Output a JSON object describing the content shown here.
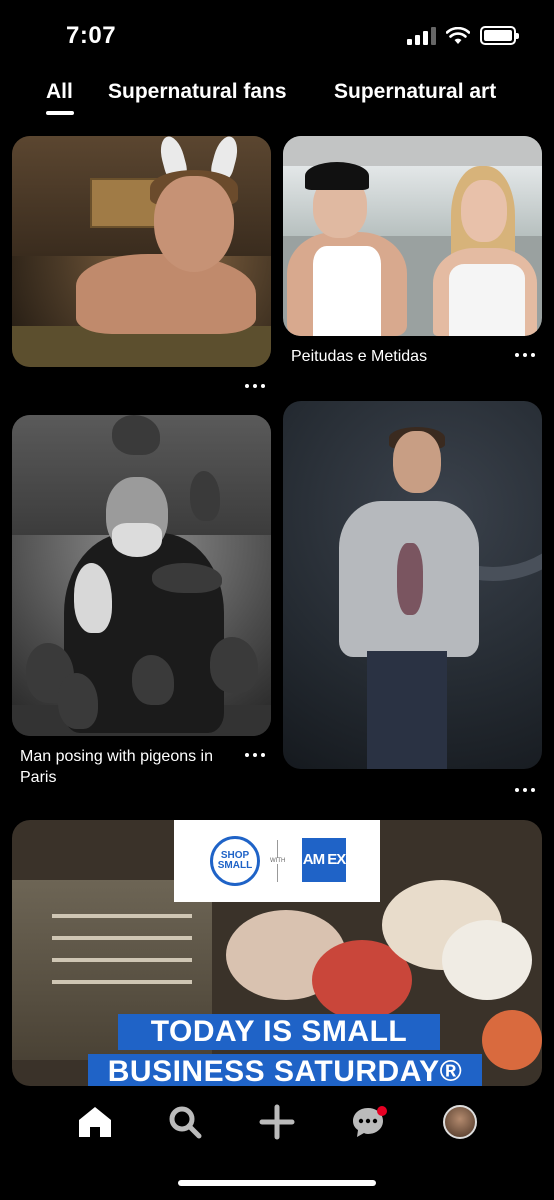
{
  "status_bar": {
    "time": "7:07"
  },
  "tabs": [
    {
      "label": "All",
      "selected": true
    },
    {
      "label": "Supernatural fans",
      "selected": false
    },
    {
      "label": "Supernatural art",
      "selected": false
    }
  ],
  "pins": [
    {
      "title": ""
    },
    {
      "title": "Peitudas e Metidas"
    },
    {
      "title": "Man posing with pigeons in Paris"
    },
    {
      "title": ""
    }
  ],
  "ad": {
    "logo_left": "SHOP SMALL",
    "logo_with": "WITH",
    "logo_right": "AM EX",
    "headline_line1": "TODAY IS SMALL",
    "headline_line2": "BUSINESS SATURDAY®"
  },
  "colors": {
    "accent_blue": "#1f63c7",
    "notification_red": "#e60023",
    "background": "#000000"
  },
  "icons": {
    "nav": [
      "home-icon",
      "search-icon",
      "plus-icon",
      "messages-icon",
      "profile-avatar"
    ]
  }
}
